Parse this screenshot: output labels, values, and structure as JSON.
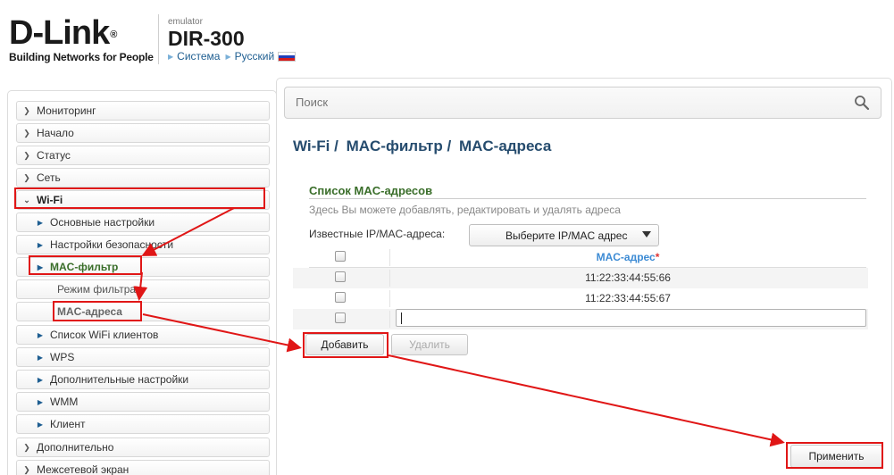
{
  "header": {
    "logo_text": "D-Link",
    "logo_reg": "®",
    "tagline": "Building Networks for People",
    "emulator_label": "emulator",
    "model": "DIR-300",
    "links": [
      "Система",
      "Русский"
    ]
  },
  "search": {
    "placeholder": "Поиск"
  },
  "sidebar": {
    "items": [
      {
        "label": "Мониторинг"
      },
      {
        "label": "Начало"
      },
      {
        "label": "Статус"
      },
      {
        "label": "Сеть"
      },
      {
        "label": "Wi-Fi"
      },
      {
        "label": "Основные настройки"
      },
      {
        "label": "Настройки безопасности"
      },
      {
        "label": "MAC-фильтр"
      },
      {
        "label": "Режим фильтра"
      },
      {
        "label": "MAC-адреса"
      },
      {
        "label": "Список WiFi клиентов"
      },
      {
        "label": "WPS"
      },
      {
        "label": "Дополнительные настройки"
      },
      {
        "label": "WMM"
      },
      {
        "label": "Клиент"
      },
      {
        "label": "Дополнительно"
      },
      {
        "label": "Межсетевой экран"
      }
    ]
  },
  "breadcrumb": [
    "Wi-Fi /",
    "MAC-фильтр /",
    "MAC-адреса"
  ],
  "section": {
    "title": "Список MAC-адресов",
    "description": "Здесь Вы можете добавлять, редактировать и удалять адреса",
    "known_label": "Известные IP/MAC-адреса:",
    "known_select_value": "Выберите IP/MAC адрес"
  },
  "table": {
    "column_header": "MAC-адрес",
    "required_mark": "*",
    "rows": [
      "11:22:33:44:55:66",
      "11:22:33:44:55:67"
    ],
    "new_value": ""
  },
  "buttons": {
    "add": "Добавить",
    "delete": "Удалить",
    "apply": "Применить"
  },
  "colors": {
    "annotation": "#e01616",
    "breadcrumb": "#264c6e",
    "section_title": "#3a6e2a",
    "column_header": "#3d8bd4"
  }
}
